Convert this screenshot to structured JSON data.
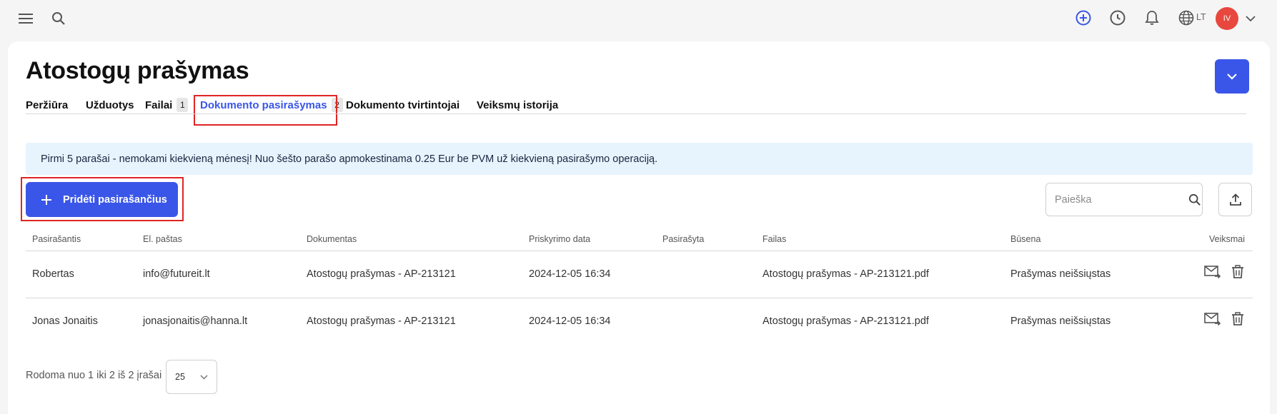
{
  "header": {
    "icons": [
      "menu-icon",
      "search-icon",
      "add-circle-icon",
      "history-icon",
      "bell-icon",
      "globe-icon",
      "chevron-down-icon"
    ],
    "language": "LT",
    "avatar_initials": "IV",
    "accent_color": "#3a56e8",
    "avatar_color": "#e8473e"
  },
  "page": {
    "title": "Atostogų prašymas"
  },
  "tabs": [
    {
      "label": "Peržiūra",
      "badge": ""
    },
    {
      "label": "Užduotys",
      "badge": ""
    },
    {
      "label": "Failai",
      "badge": "1"
    },
    {
      "label": "Dokumento pasirašymas",
      "badge": "2",
      "active": true
    },
    {
      "label": "Dokumento tvirtintojai",
      "badge": ""
    },
    {
      "label": "Veiksmų istorija",
      "badge": ""
    }
  ],
  "notice": "Pirmi 5 parašai - nemokami kiekvieną mėnesį! Nuo šešto parašo apmokestinama 0.25 Eur be PVM už kiekvieną pasirašymo operaciją.",
  "toolbar": {
    "add_label": "Pridėti pasirašančius",
    "search_placeholder": "Paieška"
  },
  "table": {
    "columns": [
      "Pasirašantis",
      "El. paštas",
      "Dokumentas",
      "Priskyrimo data",
      "Pasirašyta",
      "Failas",
      "Būsena",
      "Veiksmai"
    ],
    "rows": [
      {
        "signer": "Robertas",
        "email": "info@futureit.lt",
        "document": "Atostogų prašymas - AP-213121",
        "assigned": "2024-12-05 16:34",
        "signed": "",
        "file": "Atostogų prašymas - AP-213121.pdf",
        "status": "Prašymas neišsiųstas"
      },
      {
        "signer": "Jonas Jonaitis",
        "email": "jonasjonaitis@hanna.lt",
        "document": "Atostogų prašymas - AP-213121",
        "assigned": "2024-12-05 16:34",
        "signed": "",
        "file": "Atostogų prašymas - AP-213121.pdf",
        "status": "Prašymas neišsiųstas"
      }
    ]
  },
  "footer": {
    "summary": "Rodoma nuo 1 iki 2 iš 2 įrašai",
    "page_size": "25"
  }
}
